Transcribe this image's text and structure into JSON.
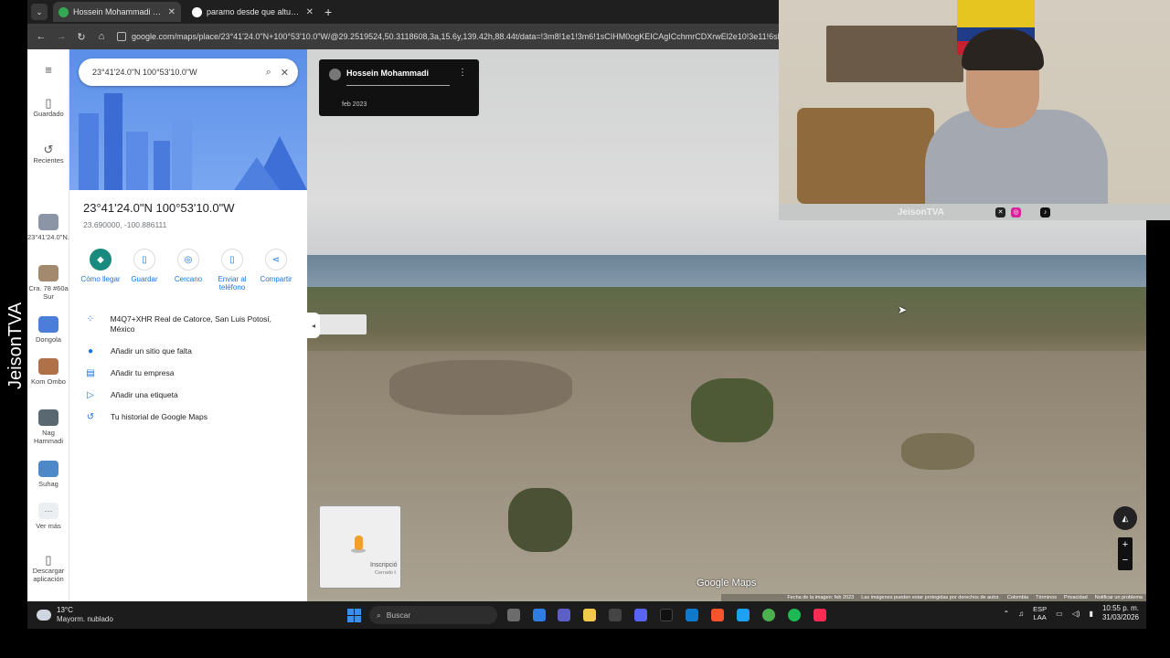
{
  "overlay": {
    "watermark": "JeisonTVA",
    "webcam_handle": "JeisonTVA"
  },
  "browser": {
    "tabs": [
      {
        "title": "Hossein Mohammadi - Google",
        "active": true
      },
      {
        "title": "paramo desde que altura - Bus",
        "active": false
      }
    ],
    "new_tab": "+",
    "url": "google.com/maps/place/23°41'24.0\"N+100°53'10.0\"W/@29.2519524,50.3118608,3a,15.6y,139.42h,88.44t/data=!3m8!1e1!3m6!1sCIHM0ogKEICAgICchmrCDXrwEl2e10!3e11!6shttps:"
  },
  "rail": {
    "saved": "Guardado",
    "recent": "Recientes",
    "items": [
      {
        "label": "23°41'24.0\"N...",
        "color": "#8b95a6"
      },
      {
        "label": "Cra. 78 #60a Sur",
        "color": "#a38a6e"
      },
      {
        "label": "Dongola",
        "color": "#4a7ed8"
      },
      {
        "label": "Kom Ombo",
        "color": "#b07048"
      },
      {
        "label": "Nag Hammadi",
        "color": "#5a6872"
      },
      {
        "label": "Suhag",
        "color": "#4d88c8"
      }
    ],
    "more": "Ver más",
    "download": "Descargar aplicación"
  },
  "panel": {
    "search_value": "23°41'24.0\"N 100°53'10.0\"W",
    "title": "23°41'24.0\"N 100°53'10.0\"W",
    "subtitle": "23.690000, -100.886111",
    "actions": [
      "Cómo llegar",
      "Guardar",
      "Cercano",
      "Enviar al teléfono",
      "Compartir"
    ],
    "rows": [
      "M4Q7+XHR Real de Catorce, San Luis Potosí, México",
      "Añadir un sitio que falta",
      "Añadir tu empresa",
      "Añadir una etiqueta",
      "Tu historial de Google Maps"
    ]
  },
  "streetview": {
    "author": "Hossein Mohammadi",
    "date": "feb 2023",
    "minimap_label": "Inscripció",
    "minimap_sub": "Cerrado t",
    "brand": "Google Maps",
    "footer": [
      "Fecha de la imagen: feb 2023",
      "Las imágenes pueden estar protegidas por derechos de autor.",
      "Colombia",
      "Términos",
      "Privacidad",
      "Notificar un problema"
    ]
  },
  "taskbar": {
    "temp": "13°C",
    "condition": "Mayorm. nublado",
    "search": "Buscar",
    "lang_top": "ESP",
    "lang_bottom": "LAA",
    "time": "10:55 p. m.",
    "date": "31/03/2026"
  }
}
